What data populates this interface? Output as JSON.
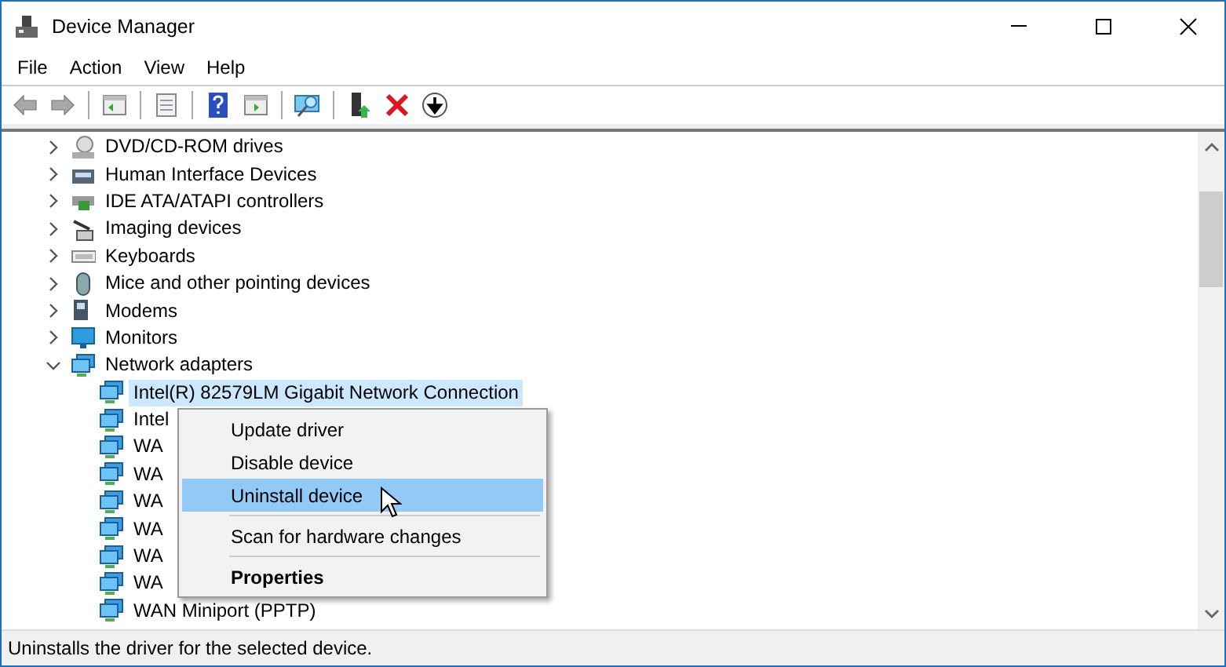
{
  "window": {
    "title": "Device Manager"
  },
  "menu_bar": [
    "File",
    "Action",
    "View",
    "Help"
  ],
  "toolbar": {
    "back_disabled": true,
    "forward_disabled": true
  },
  "tree": [
    {
      "label": "DVD/CD-ROM drives",
      "expanded": false
    },
    {
      "label": "Human Interface Devices",
      "expanded": false
    },
    {
      "label": "IDE ATA/ATAPI controllers",
      "expanded": false
    },
    {
      "label": "Imaging devices",
      "expanded": false
    },
    {
      "label": "Keyboards",
      "expanded": false
    },
    {
      "label": "Mice and other pointing devices",
      "expanded": false
    },
    {
      "label": "Modems",
      "expanded": false
    },
    {
      "label": "Monitors",
      "expanded": false
    },
    {
      "label": "Network adapters",
      "expanded": true,
      "children": [
        {
          "label": "Intel(R) 82579LM Gigabit Network Connection",
          "selected": true
        },
        {
          "label": "Intel",
          "selected": false
        },
        {
          "label": "WA",
          "selected": false
        },
        {
          "label": "WA",
          "selected": false
        },
        {
          "label": "WA",
          "selected": false
        },
        {
          "label": "WA",
          "selected": false
        },
        {
          "label": "WA",
          "selected": false
        },
        {
          "label": "WA",
          "selected": false
        },
        {
          "label": "WAN Miniport (PPTP)",
          "selected": false
        }
      ]
    }
  ],
  "context_menu": [
    {
      "kind": "item",
      "label": "Update driver",
      "selected": false
    },
    {
      "kind": "item",
      "label": "Disable device",
      "selected": false
    },
    {
      "kind": "item",
      "label": "Uninstall device",
      "selected": true
    },
    {
      "kind": "separator"
    },
    {
      "kind": "item",
      "label": "Scan for hardware changes",
      "selected": false
    },
    {
      "kind": "separator"
    },
    {
      "kind": "default",
      "label": "Properties",
      "selected": false
    }
  ],
  "status_bar": "Uninstalls the driver for the selected device."
}
